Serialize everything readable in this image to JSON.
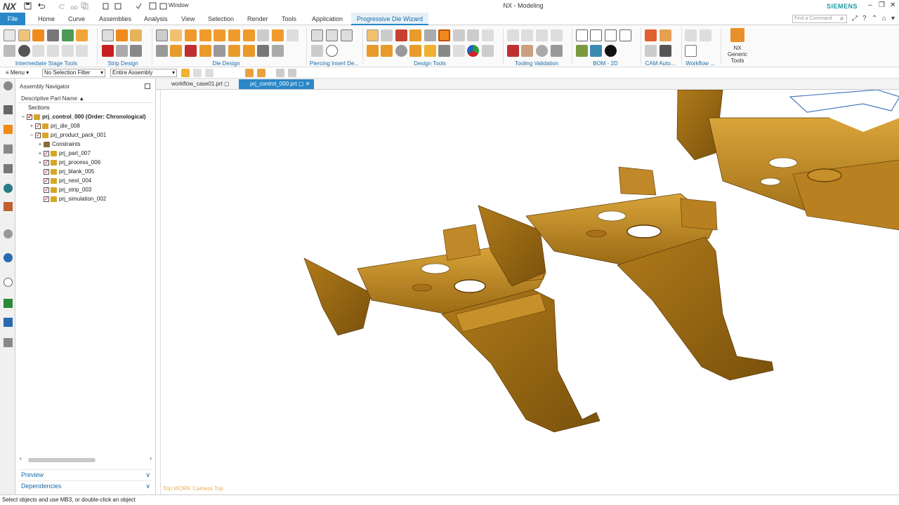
{
  "app": {
    "logo": "NX",
    "title": "NX - Modeling",
    "window_menu": "Window",
    "brand": "SIEMENS",
    "find_placeholder": "Find a Command"
  },
  "tabs": [
    "File",
    "Home",
    "Curve",
    "Assemblies",
    "Analysis",
    "View",
    "Selection",
    "Render",
    "Tools",
    "Application",
    "Progressive Die Wizard"
  ],
  "active_tab": "Progressive Die Wizard",
  "ribbon_groups": [
    "Intermediate Stage Tools",
    "Strip Design",
    "Die Design",
    "Piercing Insert De...",
    "Design Tools",
    "Tooling Validation",
    "BOM - 2D",
    "CAM Auto...",
    "Workflow ...",
    "NX Generic Tools"
  ],
  "selection_bar": {
    "menu_label": "Menu",
    "filter": "No Selection Filter",
    "scope": "Entire Assembly"
  },
  "navigator": {
    "title": "Assembly Navigator",
    "column_header": "Descriptive Part Name",
    "sections_label": "Sections",
    "items": [
      {
        "label": "prj_control_000 (Order: Chronological)",
        "bold": true
      },
      {
        "label": "prj_die_008"
      },
      {
        "label": "prj_product_pack_001"
      },
      {
        "label": "Constraints"
      },
      {
        "label": "prj_part_007"
      },
      {
        "label": "prj_process_006"
      },
      {
        "label": "prj_blank_005"
      },
      {
        "label": "prj_nest_004"
      },
      {
        "label": "prj_strip_003"
      },
      {
        "label": "prj_simulation_002"
      }
    ],
    "panels": [
      "Preview",
      "Dependencies"
    ]
  },
  "documents": [
    "workflow_case01.prt",
    "prj_control_000.prt"
  ],
  "active_document": "prj_control_000.prt",
  "viewport": {
    "label": "Top WORK Camera Top",
    "part_color": "#c8911f"
  },
  "status": "Select objects and use MB3, or double-click an object",
  "colors": {
    "accent": "#2a87c8",
    "brand": "#1a9aa0",
    "part": "#c8911f"
  }
}
